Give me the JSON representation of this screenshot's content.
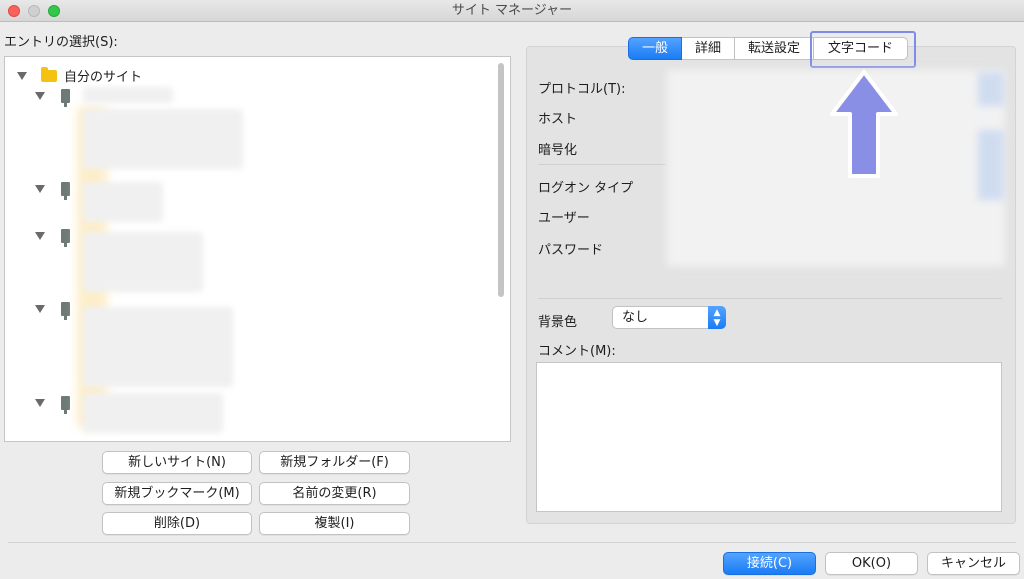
{
  "window": {
    "title": "サイト マネージャー"
  },
  "entries": {
    "label": "エントリの選択(S):",
    "root_label": "自分のサイト"
  },
  "left_buttons": {
    "new_site": "新しいサイト(N)",
    "new_folder": "新規フォルダー(F)",
    "new_bookmark": "新規ブックマーク(M)",
    "rename": "名前の変更(R)",
    "delete": "削除(D)",
    "duplicate": "複製(I)"
  },
  "tabs": [
    {
      "label": "一般",
      "active": true
    },
    {
      "label": "詳細",
      "active": false
    },
    {
      "label": "転送設定",
      "active": false
    },
    {
      "label": "文字コード",
      "active": false
    }
  ],
  "fields": {
    "protocol": "プロトコル(T):",
    "host": "ホスト",
    "encryption": "暗号化",
    "logon_type": "ログオン タイプ",
    "user": "ユーザー",
    "password": "パスワード",
    "background_color": "背景色",
    "background_color_value": "なし",
    "comment": "コメント(M):"
  },
  "bottom_buttons": {
    "connect": "接続(C)",
    "ok": "OK(O)",
    "cancel": "キャンセル"
  },
  "colors": {
    "accent": "#1a7cf5",
    "highlight": "#7f8ce6",
    "arrow": "#8a8fe6"
  },
  "icons": [
    "folder-icon",
    "server-icon",
    "disclosure-triangle-icon",
    "up-arrow-icon",
    "select-arrows-icon"
  ]
}
